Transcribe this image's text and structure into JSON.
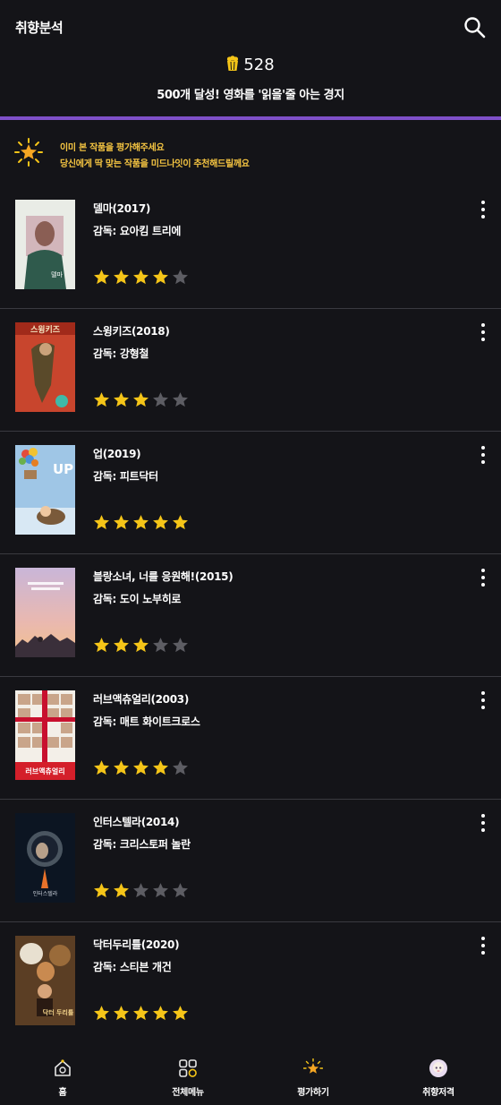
{
  "header": {
    "title": "취향분석",
    "score": "528",
    "subtitle": "500개 달성! 영화를 '읽을'줄 아는 경지"
  },
  "notice": {
    "line1": "이미 본 작품을 평가해주세요",
    "line2": "당신에게 딱 맞는 작품을 미드나잇이 추천해드릴께요"
  },
  "colors": {
    "background": "#141418",
    "accent": "#7f50c9",
    "star_filled": "#f5c518",
    "star_empty": "#5d5d63",
    "notice_text": "#f5c542"
  },
  "movies": [
    {
      "title": "델마(2017)",
      "director": "감독: 요아킴 트리에",
      "rating": 4,
      "poster_text": "델마"
    },
    {
      "title": "스윙키즈(2018)",
      "director": "감독: 강형철",
      "rating": 3,
      "poster_text": "스윙키즈"
    },
    {
      "title": "업(2019)",
      "director": "감독: 피트닥터",
      "rating": 5,
      "poster_text": "UP"
    },
    {
      "title": "블랑소녀, 너를 응원해!(2015)",
      "director": "감독: 도이 노부히로",
      "rating": 3,
      "poster_text": ""
    },
    {
      "title": "러브액츄얼리(2003)",
      "director": "감독: 매트 화이트크로스",
      "rating": 4,
      "poster_text": "러브액츄얼리"
    },
    {
      "title": "인터스텔라(2014)",
      "director": "감독: 크리스토퍼 놀란",
      "rating": 2,
      "poster_text": "인터스텔라"
    },
    {
      "title": "닥터두리틀(2020)",
      "director": "감독: 스티븐 개건",
      "rating": 5,
      "poster_text": "닥터 두리틀"
    }
  ],
  "nav": [
    {
      "label": "홈",
      "icon": "home-icon"
    },
    {
      "label": "전체메뉴",
      "icon": "grid-menu-icon"
    },
    {
      "label": "평가하기",
      "icon": "star-rate-icon"
    },
    {
      "label": "취향저격",
      "icon": "profile-avatar-icon"
    }
  ]
}
